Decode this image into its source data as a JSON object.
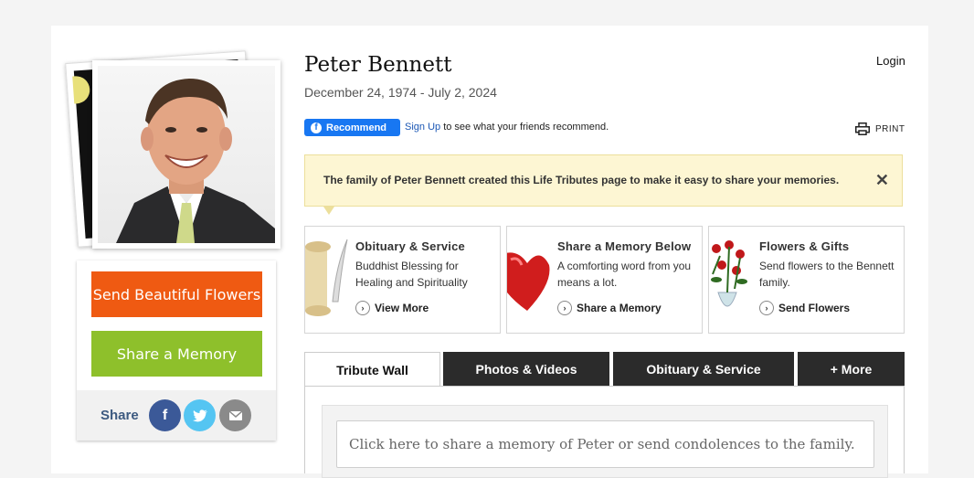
{
  "person": {
    "name": "Peter Bennett",
    "dates": "December 24, 1974 - July 2, 2024"
  },
  "header": {
    "login_label": "Login",
    "print_label": "PRINT"
  },
  "facebook": {
    "recommend_label": "Recommend",
    "signup_label": "Sign Up",
    "signup_suffix": " to see what your friends recommend."
  },
  "notice": {
    "text": "The family of Peter Bennett created this Life Tributes page to make it easy to share your memories.",
    "close_icon": "close-icon"
  },
  "actions": {
    "flowers_label": "Send Beautiful Flowers",
    "memory_label": "Share a Memory",
    "share_label": "Share"
  },
  "cards": [
    {
      "title": "Obituary & Service",
      "description": "Buddhist Blessing for Healing and Spirituality",
      "link": "View More",
      "icon": "scroll-quill-icon"
    },
    {
      "title": "Share a Memory Below",
      "description": "A comforting word from you means a lot.",
      "link": "Share a Memory",
      "icon": "heart-icon"
    },
    {
      "title": "Flowers & Gifts",
      "description": "Send flowers to the Bennett family.",
      "link": "Send Flowers",
      "icon": "rose-vase-icon"
    }
  ],
  "tabs": [
    {
      "label": "Tribute Wall",
      "active": true
    },
    {
      "label": "Photos & Videos",
      "active": false
    },
    {
      "label": "Obituary & Service",
      "active": false
    },
    {
      "label": "+ More",
      "active": false
    }
  ],
  "memory_input": {
    "placeholder": "Click here to share a memory of Peter or send condolences to the family."
  },
  "colors": {
    "flowers_button": "#ef5a12",
    "memory_button": "#8ec02b",
    "facebook": "#1877f2",
    "notice_bg": "#fdf6d3",
    "tab_dark": "#2b2b2b"
  }
}
